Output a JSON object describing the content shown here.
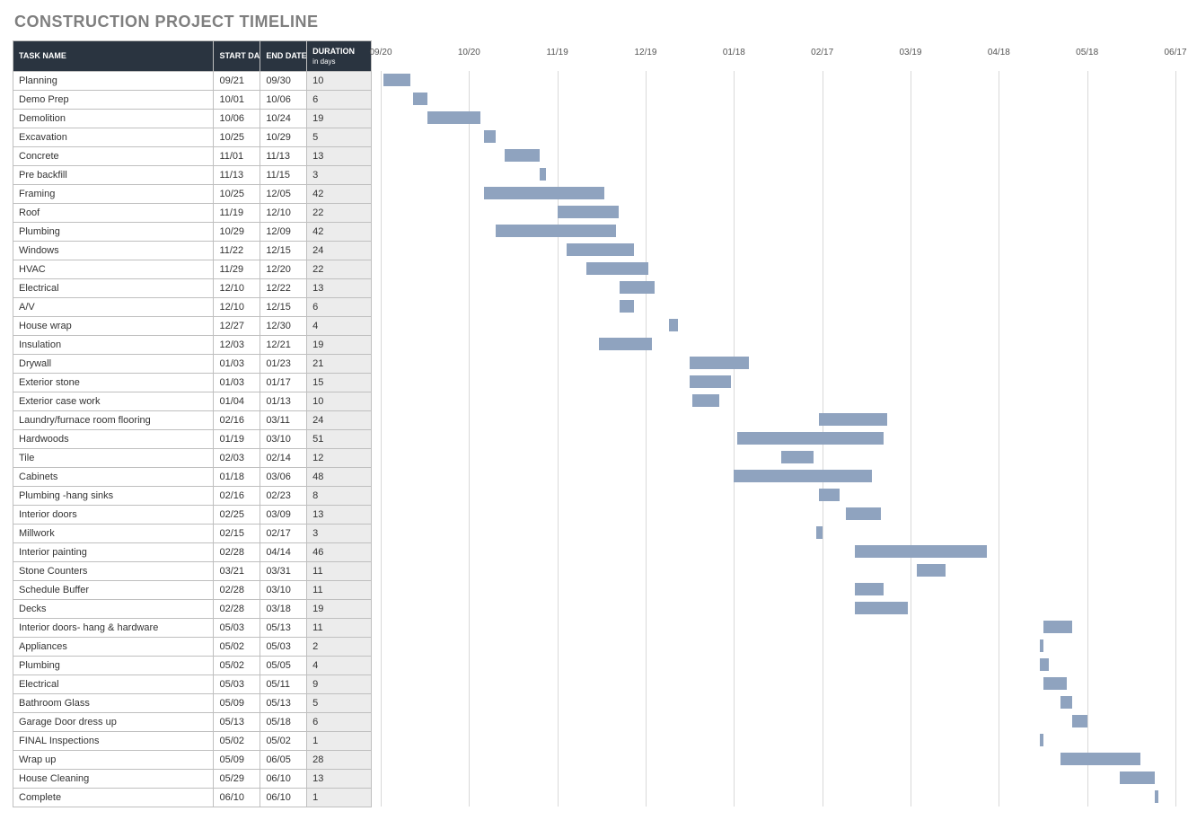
{
  "title": "CONSTRUCTION PROJECT TIMELINE",
  "table": {
    "headers": {
      "name": "TASK NAME",
      "start": "START DATE",
      "end": "END DATE",
      "duration": "DURATION",
      "duration_sub": "in days"
    }
  },
  "chart_data": {
    "type": "bar",
    "orientation": "horizontal-gantt",
    "xlabel": "",
    "ylabel": "",
    "title": "",
    "x_axis": {
      "start": "09/20",
      "end": "06/17",
      "ticks": [
        "09/20",
        "10/20",
        "11/19",
        "12/19",
        "01/18",
        "02/17",
        "03/19",
        "04/18",
        "05/18",
        "06/17"
      ]
    },
    "tasks": [
      {
        "name": "Planning",
        "start": "09/21",
        "end": "09/30",
        "duration": 10
      },
      {
        "name": "Demo Prep",
        "start": "10/01",
        "end": "10/06",
        "duration": 6
      },
      {
        "name": "Demolition",
        "start": "10/06",
        "end": "10/24",
        "duration": 19
      },
      {
        "name": "Excavation",
        "start": "10/25",
        "end": "10/29",
        "duration": 5
      },
      {
        "name": "Concrete",
        "start": "11/01",
        "end": "11/13",
        "duration": 13
      },
      {
        "name": "Pre backfill",
        "start": "11/13",
        "end": "11/15",
        "duration": 3
      },
      {
        "name": "Framing",
        "start": "10/25",
        "end": "12/05",
        "duration": 42
      },
      {
        "name": "Roof",
        "start": "11/19",
        "end": "12/10",
        "duration": 22
      },
      {
        "name": "Plumbing",
        "start": "10/29",
        "end": "12/09",
        "duration": 42
      },
      {
        "name": "Windows",
        "start": "11/22",
        "end": "12/15",
        "duration": 24
      },
      {
        "name": "HVAC",
        "start": "11/29",
        "end": "12/20",
        "duration": 22
      },
      {
        "name": "Electrical",
        "start": "12/10",
        "end": "12/22",
        "duration": 13
      },
      {
        "name": "A/V",
        "start": "12/10",
        "end": "12/15",
        "duration": 6
      },
      {
        "name": "House wrap",
        "start": "12/27",
        "end": "12/30",
        "duration": 4
      },
      {
        "name": "Insulation",
        "start": "12/03",
        "end": "12/21",
        "duration": 19
      },
      {
        "name": "Drywall",
        "start": "01/03",
        "end": "01/23",
        "duration": 21
      },
      {
        "name": "Exterior stone",
        "start": "01/03",
        "end": "01/17",
        "duration": 15
      },
      {
        "name": "Exterior case work",
        "start": "01/04",
        "end": "01/13",
        "duration": 10
      },
      {
        "name": "Laundry/furnace room flooring",
        "start": "02/16",
        "end": "03/11",
        "duration": 24
      },
      {
        "name": "Hardwoods",
        "start": "01/19",
        "end": "03/10",
        "duration": 51
      },
      {
        "name": "Tile",
        "start": "02/03",
        "end": "02/14",
        "duration": 12
      },
      {
        "name": "Cabinets",
        "start": "01/18",
        "end": "03/06",
        "duration": 48
      },
      {
        "name": "Plumbing -hang sinks",
        "start": "02/16",
        "end": "02/23",
        "duration": 8
      },
      {
        "name": "Interior doors",
        "start": "02/25",
        "end": "03/09",
        "duration": 13
      },
      {
        "name": "Millwork",
        "start": "02/15",
        "end": "02/17",
        "duration": 3
      },
      {
        "name": "Interior painting",
        "start": "02/28",
        "end": "04/14",
        "duration": 46
      },
      {
        "name": "Stone Counters",
        "start": "03/21",
        "end": "03/31",
        "duration": 11
      },
      {
        "name": "Schedule Buffer",
        "start": "02/28",
        "end": "03/10",
        "duration": 11
      },
      {
        "name": "Decks",
        "start": "02/28",
        "end": "03/18",
        "duration": 19
      },
      {
        "name": "Interior doors- hang & hardware",
        "start": "05/03",
        "end": "05/13",
        "duration": 11
      },
      {
        "name": "Appliances",
        "start": "05/02",
        "end": "05/03",
        "duration": 2
      },
      {
        "name": "Plumbing",
        "start": "05/02",
        "end": "05/05",
        "duration": 4
      },
      {
        "name": "Electrical",
        "start": "05/03",
        "end": "05/11",
        "duration": 9
      },
      {
        "name": "Bathroom Glass",
        "start": "05/09",
        "end": "05/13",
        "duration": 5
      },
      {
        "name": "Garage Door dress up",
        "start": "05/13",
        "end": "05/18",
        "duration": 6
      },
      {
        "name": "FINAL Inspections",
        "start": "05/02",
        "end": "05/02",
        "duration": 1
      },
      {
        "name": "Wrap up",
        "start": "05/09",
        "end": "06/05",
        "duration": 28
      },
      {
        "name": "House Cleaning",
        "start": "05/29",
        "end": "06/10",
        "duration": 13
      },
      {
        "name": "Complete",
        "start": "06/10",
        "end": "06/10",
        "duration": 1
      }
    ]
  }
}
